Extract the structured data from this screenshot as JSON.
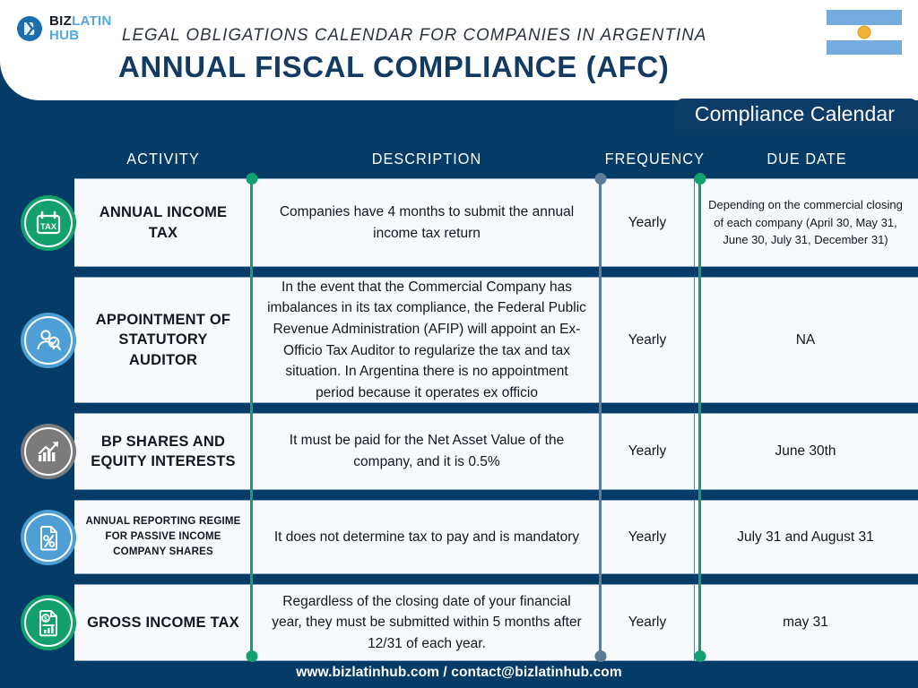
{
  "brand": {
    "logo_biz": "BIZ",
    "logo_latin": "LATIN",
    "logo_hub": "HUB",
    "logo_icon": "bizlatinhub-logo-icon",
    "flag_icon": "argentina-flag-icon"
  },
  "header": {
    "subtitle": "LEGAL OBLIGATIONS CALENDAR FOR COMPANIES IN ARGENTINA",
    "title": "ANNUAL FISCAL COMPLIANCE (AFC)"
  },
  "badge": {
    "label": "Compliance Calendar"
  },
  "columns": {
    "activity": "ACTIVITY",
    "description": "DESCRIPTION",
    "frequency": "FREQUENCY",
    "due_date": "DUE DATE"
  },
  "rows": [
    {
      "icon": "tax-calendar-icon",
      "icon_color": "#12a06c",
      "activity": "ANNUAL INCOME TAX",
      "description": "Companies have 4 months to submit the annual income tax return",
      "frequency": "Yearly",
      "due_date": "Depending on the commercial closing of each company (April 30, May 31, June 30, July 31, December 31)"
    },
    {
      "icon": "auditor-person-icon",
      "icon_color": "#4d9fd6",
      "activity": "APPOINTMENT OF STATUTORY AUDITOR",
      "description": "In the event that the Commercial Company has imbalances in its tax compliance, the Federal Public Revenue Administration (AFIP) will appoint an Ex-Officio Tax Auditor to regularize the tax and tax situation. In Argentina there is no appointment period because it operates ex officio",
      "frequency": "Yearly",
      "due_date": "NA"
    },
    {
      "icon": "growth-chart-icon",
      "icon_color": "#7b7b7b",
      "activity": "BP SHARES AND EQUITY INTERESTS",
      "description": "It must be paid for the Net Asset Value of the company, and it is 0.5%",
      "frequency": "Yearly",
      "due_date": "June 30th"
    },
    {
      "icon": "document-percent-icon",
      "icon_color": "#4d9fd6",
      "activity": "ANNUAL REPORTING REGIME FOR PASSIVE INCOME COMPANY SHARES",
      "description": "It does not determine tax to pay and is mandatory",
      "frequency": "Yearly",
      "due_date": "July 31 and August 31"
    },
    {
      "icon": "document-dollar-chart-icon",
      "icon_color": "#12a06c",
      "activity": "GROSS INCOME TAX",
      "description": "Regardless of the closing date of your financial year, they must be submitted within 5 months after 12/31 of each year.",
      "frequency": "Yearly",
      "due_date": "may 31"
    }
  ],
  "footer": {
    "contact": "www.bizlatinhub.com / contact@bizlatinhub.com"
  },
  "colors": {
    "navy": "#043c67",
    "badge_navy": "#0c3d69",
    "green": "#12a06c",
    "gray_blue": "#5c7d99",
    "cell_bg": "#f8f9fc",
    "flag_blue": "#74acdf",
    "logo_blue": "#54a8e0"
  }
}
